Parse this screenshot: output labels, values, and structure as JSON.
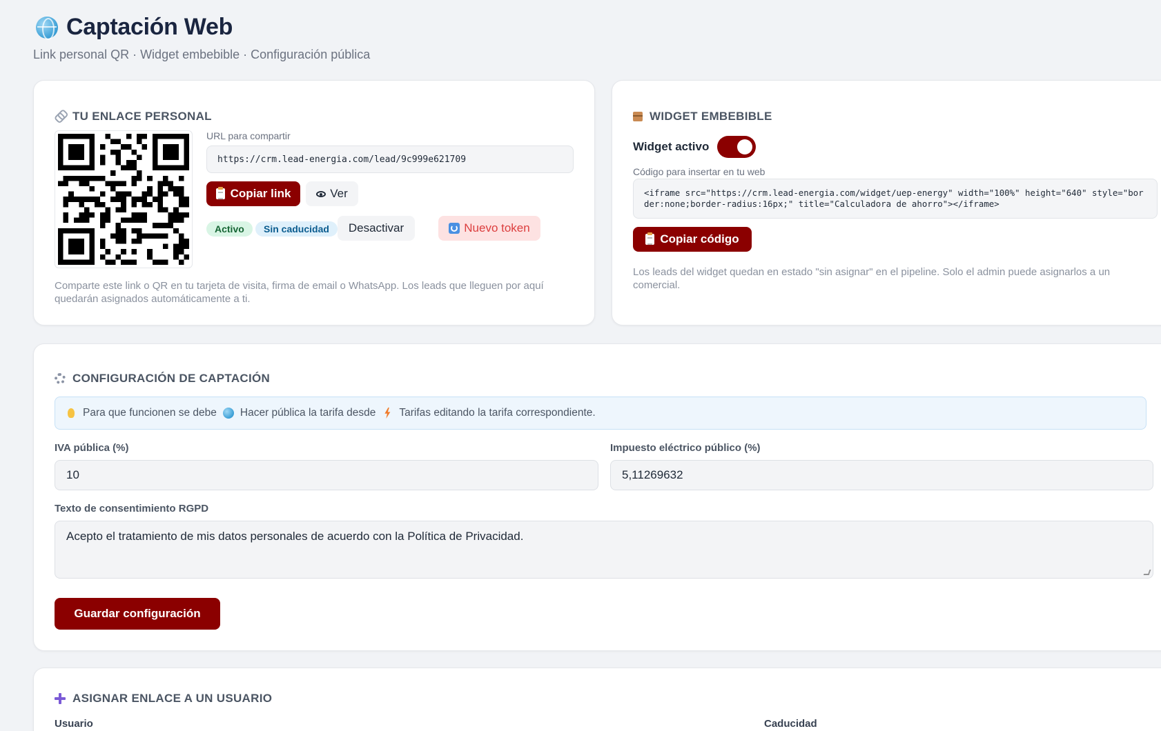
{
  "header": {
    "title": "Captación Web",
    "subtitle": "Link personal QR · Widget embebible · Configuración pública"
  },
  "personal_link": {
    "title": "TU ENLACE PERSONAL",
    "url_label": "URL para compartir",
    "url": "https://crm.lead-energia.com/lead/9c999e621709",
    "copy_button": "Copiar link",
    "view_button": "Ver",
    "badge_active": "Activo",
    "badge_expiry": "Sin caducidad",
    "deactivate_button": "Desactivar",
    "new_token_button": "Nuevo token",
    "note": "Comparte este link o QR en tu tarjeta de visita, firma de email o WhatsApp. Los leads que lleguen por aquí quedarán asignados automáticamente a ti."
  },
  "widget": {
    "title": "WIDGET EMBEBIBLE",
    "toggle_label": "Widget activo",
    "toggle_on": true,
    "code_label": "Código para insertar en tu web",
    "code": "<iframe src=\"https://crm.lead-energia.com/widget/uep-energy\" width=\"100%\" height=\"640\" style=\"border:none;border-radius:16px;\" title=\"Calculadora de ahorro\"></iframe>",
    "copy_button": "Copiar código",
    "note": "Los leads del widget quedan en estado \"sin asignar\" en el pipeline. Solo el admin puede asignarlos a un comercial."
  },
  "config": {
    "title": "CONFIGURACIÓN DE CAPTACIÓN",
    "info_part1": "Para que funcionen se debe",
    "info_part2": "Hacer pública la tarifa desde",
    "info_part3": "Tarifas editando la tarifa correspondiente.",
    "iva_label": "IVA pública (%)",
    "iva_value": "10",
    "tax_label": "Impuesto eléctrico público (%)",
    "tax_value": "5,11269632",
    "rgpd_label": "Texto de consentimiento RGPD",
    "rgpd_value": "Acepto el tratamiento de mis datos personales de acuerdo con la Política de Privacidad.",
    "save_button": "Guardar configuración"
  },
  "assign": {
    "title": "ASIGNAR ENLACE A UN USUARIO",
    "user_label": "Usuario",
    "expiry_label": "Caducidad"
  },
  "colors": {
    "primary": "#8b0000",
    "background": "#f1f3f6",
    "badge_active_bg": "#d9f5e5",
    "badge_expiry_bg": "#dff0fb",
    "new_token_bg": "#fde2e2",
    "info_bg": "#eef6fd"
  }
}
